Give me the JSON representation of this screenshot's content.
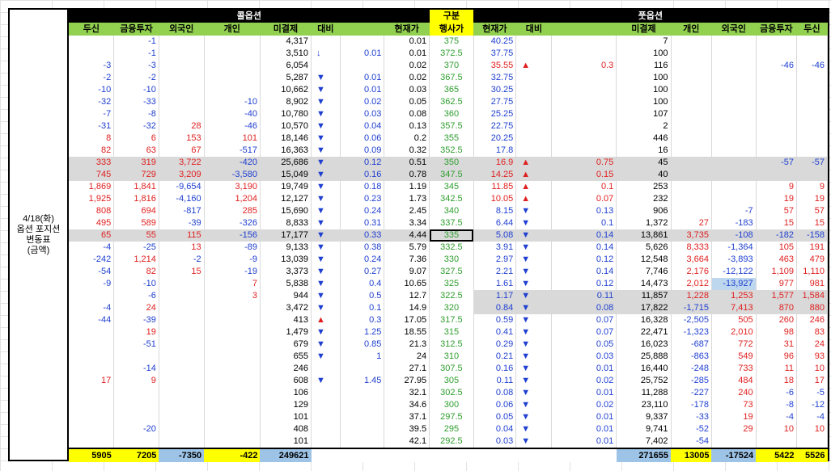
{
  "side_label": "4/18(화)\n옵션 포지션\n변동표\n(금액)",
  "header": {
    "call_section": "콜옵션",
    "gubun": "구분",
    "put_section": "풋옵션"
  },
  "columns": {
    "call": [
      "두신",
      "금융투자",
      "외국인",
      "개인",
      "미결제",
      "대비",
      "",
      "현재가"
    ],
    "strike": "행사가",
    "put": [
      "현재가",
      "대비",
      "",
      "미결제",
      "개인",
      "외국인",
      "금융투자",
      "두신"
    ]
  },
  "arrows": {
    "up": "▲",
    "down": "▼",
    "down_thin": "↓"
  },
  "rows": [
    {
      "c_tusin": "",
      "c_fin": "-1",
      "c_for": "",
      "c_ind": "",
      "c_oi": "4,317",
      "c_ind_arrow": "",
      "c_chg": "",
      "c_price": "0.01",
      "strike": "375",
      "p_price": "40.25",
      "p_arrow": "",
      "p_chg": "",
      "p_oi": "7",
      "p_ind": "",
      "p_for": "",
      "p_fin": "",
      "p_tusin": ""
    },
    {
      "c_tusin": "",
      "c_fin": "-1",
      "c_for": "",
      "c_ind": "",
      "c_oi": "3,510",
      "c_ind_arrow": "down_thin",
      "c_chg": "0.01",
      "c_price": "0.01",
      "strike": "372.5",
      "p_price": "37.75",
      "p_arrow": "",
      "p_chg": "",
      "p_oi": "100",
      "p_ind": "",
      "p_for": "",
      "p_fin": "",
      "p_tusin": ""
    },
    {
      "c_tusin": "-3",
      "c_fin": "-3",
      "c_for": "",
      "c_ind": "",
      "c_oi": "6,054",
      "c_ind_arrow": "",
      "c_chg": "",
      "c_price": "0.02",
      "strike": "370",
      "p_price": "35.55",
      "p_arrow": "up",
      "p_chg": "0.3",
      "p_oi": "116",
      "p_ind": "",
      "p_for": "",
      "p_fin": "-46",
      "p_tusin": "-46"
    },
    {
      "c_tusin": "-2",
      "c_fin": "-2",
      "c_for": "",
      "c_ind": "",
      "c_oi": "5,287",
      "c_ind_arrow": "down",
      "c_chg": "0.01",
      "c_price": "0.02",
      "strike": "367.5",
      "p_price": "32.75",
      "p_arrow": "",
      "p_chg": "",
      "p_oi": "100",
      "p_ind": "",
      "p_for": "",
      "p_fin": "",
      "p_tusin": ""
    },
    {
      "c_tusin": "-10",
      "c_fin": "-10",
      "c_for": "",
      "c_ind": "",
      "c_oi": "10,662",
      "c_ind_arrow": "down",
      "c_chg": "0.01",
      "c_price": "0.03",
      "strike": "365",
      "p_price": "30.25",
      "p_arrow": "",
      "p_chg": "",
      "p_oi": "100",
      "p_ind": "",
      "p_for": "",
      "p_fin": "",
      "p_tusin": ""
    },
    {
      "c_tusin": "-32",
      "c_fin": "-33",
      "c_for": "",
      "c_ind": "-10",
      "c_oi": "8,902",
      "c_ind_arrow": "down",
      "c_chg": "0.02",
      "c_price": "0.05",
      "strike": "362.5",
      "p_price": "27.75",
      "p_arrow": "",
      "p_chg": "",
      "p_oi": "100",
      "p_ind": "",
      "p_for": "",
      "p_fin": "",
      "p_tusin": ""
    },
    {
      "c_tusin": "-7",
      "c_fin": "-8",
      "c_for": "",
      "c_ind": "-40",
      "c_oi": "10,780",
      "c_ind_arrow": "down",
      "c_chg": "0.03",
      "c_price": "0.08",
      "strike": "360",
      "p_price": "25.25",
      "p_arrow": "",
      "p_chg": "",
      "p_oi": "107",
      "p_ind": "",
      "p_for": "",
      "p_fin": "",
      "p_tusin": ""
    },
    {
      "c_tusin": "-31",
      "c_fin": "-32",
      "c_for": "28",
      "c_ind": "-46",
      "c_oi": "10,570",
      "c_ind_arrow": "down",
      "c_chg": "0.04",
      "c_price": "0.13",
      "strike": "357.5",
      "p_price": "22.75",
      "p_arrow": "",
      "p_chg": "",
      "p_oi": "2",
      "p_ind": "",
      "p_for": "",
      "p_fin": "",
      "p_tusin": ""
    },
    {
      "c_tusin": "8",
      "c_fin": "6",
      "c_for": "153",
      "c_ind": "101",
      "c_oi": "18,146",
      "c_ind_arrow": "down",
      "c_chg": "0.06",
      "c_price": "0.2",
      "strike": "355",
      "p_price": "20.25",
      "p_arrow": "",
      "p_chg": "",
      "p_oi": "446",
      "p_ind": "",
      "p_for": "",
      "p_fin": "",
      "p_tusin": ""
    },
    {
      "c_tusin": "82",
      "c_fin": "63",
      "c_for": "67",
      "c_ind": "-517",
      "c_oi": "16,363",
      "c_ind_arrow": "down",
      "c_chg": "0.09",
      "c_price": "0.32",
      "strike": "352.5",
      "p_price": "17.8",
      "p_arrow": "",
      "p_chg": "",
      "p_oi": "16",
      "p_ind": "",
      "p_for": "",
      "p_fin": "",
      "p_tusin": ""
    },
    {
      "gray": true,
      "c_tusin": "333",
      "c_fin": "319",
      "c_for": "3,722",
      "c_ind": "-420",
      "c_oi": "25,686",
      "c_ind_arrow": "down",
      "c_chg": "0.12",
      "c_price": "0.51",
      "strike": "350",
      "p_price": "16.9",
      "p_arrow": "up",
      "p_chg": "0.75",
      "p_oi": "45",
      "p_ind": "",
      "p_for": "",
      "p_fin": "-57",
      "p_tusin": "-57"
    },
    {
      "gray": true,
      "c_tusin": "745",
      "c_fin": "729",
      "c_for": "3,209",
      "c_ind": "-3,580",
      "c_oi": "15,049",
      "c_ind_arrow": "down",
      "c_chg": "0.16",
      "c_price": "0.78",
      "strike": "347.5",
      "p_price": "14.25",
      "p_arrow": "up",
      "p_chg": "0.15",
      "p_oi": "40",
      "p_ind": "",
      "p_for": "",
      "p_fin": "",
      "p_tusin": ""
    },
    {
      "c_tusin": "1,869",
      "c_fin": "1,841",
      "c_for": "-9,654",
      "c_ind": "3,190",
      "c_oi": "19,749",
      "c_ind_arrow": "down",
      "c_chg": "0.18",
      "c_price": "1.19",
      "strike": "345",
      "p_price": "11.85",
      "p_arrow": "up",
      "p_chg": "0.1",
      "p_oi": "253",
      "p_ind": "",
      "p_for": "",
      "p_fin": "9",
      "p_tusin": "9"
    },
    {
      "c_tusin": "1,925",
      "c_fin": "1,816",
      "c_for": "-4,160",
      "c_ind": "1,204",
      "c_oi": "12,127",
      "c_ind_arrow": "down",
      "c_chg": "0.23",
      "c_price": "1.73",
      "strike": "342.5",
      "p_price": "10.05",
      "p_arrow": "up",
      "p_chg": "0.07",
      "p_oi": "232",
      "p_ind": "",
      "p_for": "",
      "p_fin": "19",
      "p_tusin": "19"
    },
    {
      "c_tusin": "808",
      "c_fin": "694",
      "c_for": "-817",
      "c_ind": "285",
      "c_oi": "15,690",
      "c_ind_arrow": "down",
      "c_chg": "0.24",
      "c_price": "2.45",
      "strike": "340",
      "p_price": "8.15",
      "p_arrow": "down",
      "p_chg": "0.13",
      "p_oi": "906",
      "p_ind": "",
      "p_for": "-7",
      "p_fin": "57",
      "p_tusin": "57"
    },
    {
      "c_tusin": "495",
      "c_fin": "589",
      "c_for": "-39",
      "c_ind": "-326",
      "c_oi": "8,833",
      "c_ind_arrow": "down",
      "c_chg": "0.31",
      "c_price": "3.34",
      "strike": "337.5",
      "p_price": "6.44",
      "p_arrow": "down",
      "p_chg": "0.1",
      "p_oi": "1,372",
      "p_ind": "27",
      "p_for": "-183",
      "p_fin": "15",
      "p_tusin": "15"
    },
    {
      "gray": true,
      "atm": true,
      "c_tusin": "65",
      "c_fin": "55",
      "c_for": "115",
      "c_ind": "-156",
      "c_oi": "17,177",
      "c_ind_arrow": "down",
      "c_chg": "0.33",
      "c_price": "4.44",
      "strike": "335",
      "p_price": "5.08",
      "p_arrow": "down",
      "p_chg": "0.14",
      "p_oi": "13,861",
      "p_ind": "3,735",
      "p_for": "-108",
      "p_fin": "-182",
      "p_tusin": "-158"
    },
    {
      "c_tusin": "-4",
      "c_fin": "-25",
      "c_for": "13",
      "c_ind": "-89",
      "c_oi": "9,133",
      "c_ind_arrow": "down",
      "c_chg": "0.38",
      "c_price": "5.79",
      "strike": "332.5",
      "p_price": "3.91",
      "p_arrow": "down",
      "p_chg": "0.14",
      "p_oi": "5,626",
      "p_ind": "8,333",
      "p_for": "-1,364",
      "p_fin": "105",
      "p_tusin": "191"
    },
    {
      "c_tusin": "-242",
      "c_fin": "1,214",
      "c_for": "-2",
      "c_ind": "-9",
      "c_oi": "13,039",
      "c_ind_arrow": "down",
      "c_chg": "0.24",
      "c_price": "7.36",
      "strike": "330",
      "p_price": "2.97",
      "p_arrow": "down",
      "p_chg": "0.12",
      "p_oi": "12,548",
      "p_ind": "3,664",
      "p_for": "-3,893",
      "p_fin": "463",
      "p_tusin": "479"
    },
    {
      "c_tusin": "-54",
      "c_fin": "82",
      "c_for": "15",
      "c_ind": "-19",
      "c_oi": "3,373",
      "c_ind_arrow": "down",
      "c_chg": "0.27",
      "c_price": "9.07",
      "strike": "327.5",
      "p_price": "2.21",
      "p_arrow": "down",
      "p_chg": "0.14",
      "p_oi": "7,746",
      "p_ind": "2,176",
      "p_for": "-12,122",
      "p_fin": "1,109",
      "p_tusin": "1,110"
    },
    {
      "c_tusin": "-9",
      "c_fin": "-10",
      "c_for": "",
      "c_ind": "7",
      "c_oi": "5,838",
      "c_ind_arrow": "down",
      "c_chg": "0.4",
      "c_price": "10.65",
      "strike": "325",
      "p_price": "1.61",
      "p_arrow": "down",
      "p_chg": "0.12",
      "p_oi": "14,473",
      "p_ind": "2,012",
      "p_for": "-13,927",
      "p_for_hl": true,
      "p_fin": "977",
      "p_tusin": "981"
    },
    {
      "gray_put": true,
      "c_tusin": "",
      "c_fin": "-6",
      "c_for": "",
      "c_ind": "3",
      "c_oi": "944",
      "c_ind_arrow": "down",
      "c_chg": "0.5",
      "c_price": "12.7",
      "strike": "322.5",
      "p_price": "1.17",
      "p_arrow": "down",
      "p_chg": "0.11",
      "p_oi": "11,857",
      "p_ind": "1,228",
      "p_for": "1,253",
      "p_fin": "1,577",
      "p_tusin": "1,584"
    },
    {
      "gray_put": true,
      "c_tusin": "-4",
      "c_fin": "24",
      "c_for": "",
      "c_ind": "",
      "c_oi": "3,472",
      "c_ind_arrow": "down",
      "c_chg": "0.1",
      "c_price": "14.9",
      "strike": "320",
      "p_price": "0.84",
      "p_arrow": "down",
      "p_chg": "0.08",
      "p_oi": "17,822",
      "p_ind": "-1,715",
      "p_for": "7,413",
      "p_fin": "870",
      "p_tusin": "880"
    },
    {
      "c_tusin": "-44",
      "c_fin": "-39",
      "c_for": "",
      "c_ind": "",
      "c_oi": "413",
      "c_ind_arrow": "up",
      "c_chg": "0.3",
      "c_price": "17.05",
      "strike": "317.5",
      "p_price": "0.59",
      "p_arrow": "down",
      "p_chg": "0.07",
      "p_oi": "16,328",
      "p_ind": "-2,505",
      "p_for": "505",
      "p_fin": "260",
      "p_tusin": "246"
    },
    {
      "c_tusin": "",
      "c_fin": "19",
      "c_for": "",
      "c_ind": "",
      "c_oi": "1,479",
      "c_ind_arrow": "down",
      "c_chg": "1.25",
      "c_price": "18.55",
      "strike": "315",
      "p_price": "0.41",
      "p_arrow": "down",
      "p_chg": "0.07",
      "p_oi": "22,471",
      "p_ind": "-1,323",
      "p_for": "2,010",
      "p_fin": "98",
      "p_tusin": "83"
    },
    {
      "c_tusin": "",
      "c_fin": "-51",
      "c_for": "",
      "c_ind": "",
      "c_oi": "679",
      "c_ind_arrow": "down",
      "c_chg": "0.85",
      "c_price": "21.3",
      "strike": "312.5",
      "p_price": "0.29",
      "p_arrow": "down",
      "p_chg": "0.05",
      "p_oi": "16,023",
      "p_ind": "-687",
      "p_for": "772",
      "p_fin": "31",
      "p_tusin": "24"
    },
    {
      "c_tusin": "",
      "c_fin": "",
      "c_for": "",
      "c_ind": "",
      "c_oi": "655",
      "c_ind_arrow": "down",
      "c_chg": "1",
      "c_price": "24",
      "strike": "310",
      "p_price": "0.21",
      "p_arrow": "down",
      "p_chg": "0.03",
      "p_oi": "25,888",
      "p_ind": "-863",
      "p_for": "549",
      "p_fin": "96",
      "p_tusin": "93"
    },
    {
      "c_tusin": "",
      "c_fin": "-14",
      "c_for": "",
      "c_ind": "",
      "c_oi": "246",
      "c_ind_arrow": "",
      "c_chg": "",
      "c_price": "27.1",
      "strike": "307.5",
      "p_price": "0.16",
      "p_arrow": "down",
      "p_chg": "0.01",
      "p_oi": "16,440",
      "p_ind": "-248",
      "p_for": "733",
      "p_fin": "11",
      "p_tusin": "10"
    },
    {
      "c_tusin": "17",
      "c_fin": "9",
      "c_for": "",
      "c_ind": "",
      "c_oi": "608",
      "c_ind_arrow": "down",
      "c_chg": "1.45",
      "c_price": "27.95",
      "strike": "305",
      "p_price": "0.11",
      "p_arrow": "down",
      "p_chg": "0.02",
      "p_oi": "25,752",
      "p_ind": "-285",
      "p_for": "484",
      "p_fin": "18",
      "p_tusin": "17"
    },
    {
      "c_tusin": "",
      "c_fin": "",
      "c_for": "",
      "c_ind": "",
      "c_oi": "106",
      "c_ind_arrow": "",
      "c_chg": "",
      "c_price": "32.1",
      "strike": "302.5",
      "p_price": "0.08",
      "p_arrow": "down",
      "p_chg": "0.01",
      "p_oi": "11,288",
      "p_ind": "-227",
      "p_for": "240",
      "p_fin": "-6",
      "p_tusin": "-5"
    },
    {
      "c_tusin": "",
      "c_fin": "",
      "c_for": "",
      "c_ind": "",
      "c_oi": "129",
      "c_ind_arrow": "",
      "c_chg": "",
      "c_price": "34.6",
      "strike": "300",
      "p_price": "0.06",
      "p_arrow": "down",
      "p_chg": "0.02",
      "p_oi": "23,110",
      "p_ind": "-178",
      "p_for": "73",
      "p_fin": "-8",
      "p_tusin": "-12"
    },
    {
      "c_tusin": "",
      "c_fin": "",
      "c_for": "",
      "c_ind": "",
      "c_oi": "101",
      "c_ind_arrow": "",
      "c_chg": "",
      "c_price": "37.1",
      "strike": "297.5",
      "p_price": "0.05",
      "p_arrow": "down",
      "p_chg": "0.01",
      "p_oi": "9,337",
      "p_ind": "-33",
      "p_for": "19",
      "p_fin": "-4",
      "p_tusin": "-4"
    },
    {
      "c_tusin": "",
      "c_fin": "-20",
      "c_for": "",
      "c_ind": "",
      "c_oi": "408",
      "c_ind_arrow": "",
      "c_chg": "",
      "c_price": "39.5",
      "strike": "295",
      "p_price": "0.04",
      "p_arrow": "down",
      "p_chg": "0.01",
      "p_oi": "9,741",
      "p_ind": "-52",
      "p_for": "29",
      "p_fin": "10",
      "p_tusin": "10"
    },
    {
      "c_tusin": "",
      "c_fin": "",
      "c_for": "",
      "c_ind": "",
      "c_oi": "101",
      "c_ind_arrow": "",
      "c_chg": "",
      "c_price": "42.1",
      "strike": "292.5",
      "p_price": "0.03",
      "p_arrow": "down",
      "p_chg": "0.01",
      "p_oi": "7,402",
      "p_ind": "-54",
      "p_for": "",
      "p_fin": "",
      "p_tusin": ""
    }
  ],
  "totals": {
    "c_tusin": "5905",
    "c_fin": "7205",
    "c_for": "-7350",
    "c_ind": "-422",
    "c_oi": "249621",
    "p_oi": "271655",
    "p_ind": "13005",
    "p_for": "-17524",
    "p_fin": "5422",
    "p_tusin": "5526"
  },
  "colors": {
    "header_black": "#000000",
    "header_green": "#92d050",
    "yellow": "#ffff00",
    "light_blue": "#9dc3e6",
    "gray_row": "#d9d9d9",
    "positive": "#e02020",
    "negative": "#1f3fd0",
    "strike": "#2e9e2e"
  }
}
